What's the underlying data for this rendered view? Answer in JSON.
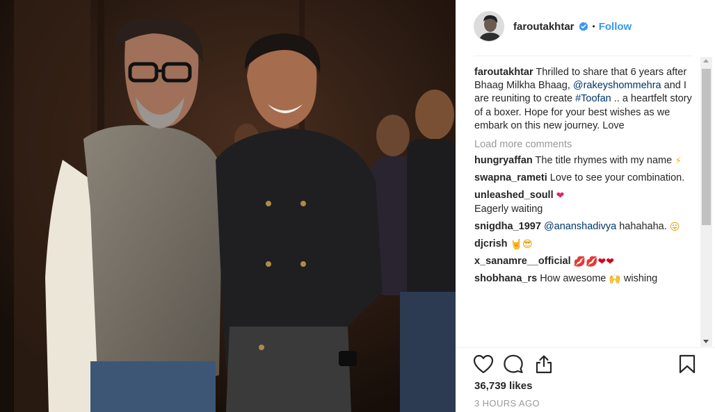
{
  "post": {
    "username": "faroutakhtar",
    "verified": true,
    "follow_label": "Follow",
    "separator": "•",
    "caption": {
      "username": "faroutakhtar",
      "text_1": " Thrilled to share that 6 years after Bhaag Milkha Bhaag, ",
      "mention": "@rakeyshommehra",
      "text_2": " and I are reuniting to create ",
      "hashtag": "#Toofan",
      "text_3": " .. a heartfelt story of a boxer.  Hope for your best wishes as we embark on this new journey. Love"
    },
    "load_more_label": "Load more comments",
    "comments": [
      {
        "username": "hungryaffan",
        "text": " The title rhymes with my name ",
        "emoji": "⚡"
      },
      {
        "username": "swapna_rameti",
        "text": " Love to see your combination.",
        "emoji": ""
      },
      {
        "username": "unleashed_soull",
        "text": " ",
        "emoji": "❤",
        "text_after": "Eagerly waiting"
      },
      {
        "username": "snigdha_1997",
        "text": " ",
        "mention": "@ananshadivya",
        "text_after": " hahahaha. ",
        "emoji": "😛"
      },
      {
        "username": "djcrish",
        "text": " ",
        "emoji": "🤘😎"
      },
      {
        "username": "x_sanamre__official",
        "text": " ",
        "emoji": "💋💋❤❤"
      },
      {
        "username": "shobhana_rs",
        "text": " How awesome ",
        "emoji": "🙌",
        "text_after": " wishing"
      }
    ],
    "likes_text": "36,739 likes",
    "time_text": "3 HOURS AGO"
  },
  "icons": {
    "like": "heart-icon",
    "comment": "speech-bubble-icon",
    "share": "share-icon",
    "save": "bookmark-icon",
    "verified": "verified-badge-icon"
  },
  "colors": {
    "accent": "#3897f0",
    "link": "#003569",
    "muted": "#999999",
    "text": "#262626"
  }
}
